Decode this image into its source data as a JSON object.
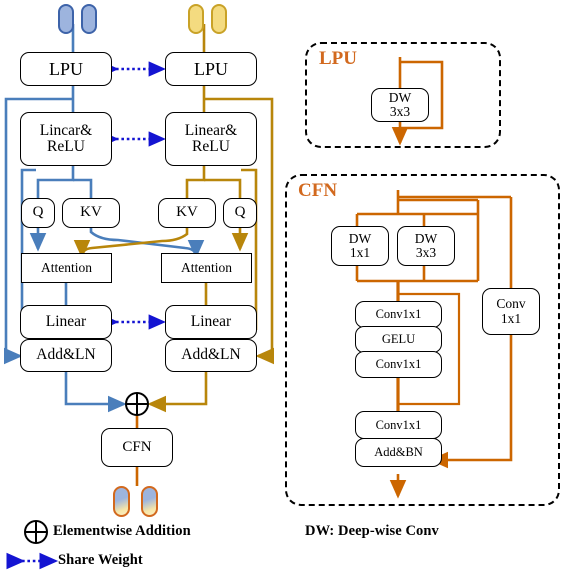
{
  "figure": {
    "title": "Dual-branch cross-attention transformer block with LPU and CFN details",
    "colors": {
      "blue_line": "#4A7EBB",
      "gold_line": "#B8860B",
      "orange_line": "#CC6600",
      "share_weight_arrow": "#1414D2",
      "blue_token_fill": "#9DB4DE",
      "blue_token_border": "#3D63A9",
      "gold_token_fill": "#F4DB80",
      "gold_token_border": "#C9A227",
      "panel_title": "#D2691E",
      "box_border": "#000000"
    }
  },
  "left_panel": {
    "branch_blue": {
      "lpu": "LPU",
      "linear_relu": "Lincar&\nReLU",
      "linear_relu_line1": "Lincar&",
      "linear_relu_line2": "ReLU",
      "q": "Q",
      "kv": "KV",
      "attention": "Attention",
      "linear": "Linear",
      "add_ln": "Add&LN"
    },
    "branch_gold": {
      "lpu": "LPU",
      "linear_relu_line1": "Linear&",
      "linear_relu_line2": "ReLU",
      "kv": "KV",
      "q": "Q",
      "attention": "Attention",
      "linear": "Linear",
      "add_ln": "Add&LN"
    },
    "merge": {
      "operator": "⊕",
      "cfn": "CFN"
    }
  },
  "right_panel": {
    "lpu": {
      "title": "LPU",
      "dw_line1": "DW",
      "dw_line2": "3x3"
    },
    "cfn": {
      "title": "CFN",
      "dw1_line1": "DW",
      "dw1_line2": "1x1",
      "dw2_line1": "DW",
      "dw2_line2": "3x3",
      "conv_a": "Conv1x1",
      "gelu": "GELU",
      "conv_b": "Conv1x1",
      "conv_c": "Conv1x1",
      "add_bn": "Add&BN",
      "shortcut_conv_line1": "Conv",
      "shortcut_conv_line2": "1x1"
    }
  },
  "legend": {
    "plus_symbol": "⊕",
    "plus_label": "Elementwise Addition",
    "share_weight_label": "Share Weight",
    "dw_label": "DW:  Deep-wise Conv"
  }
}
